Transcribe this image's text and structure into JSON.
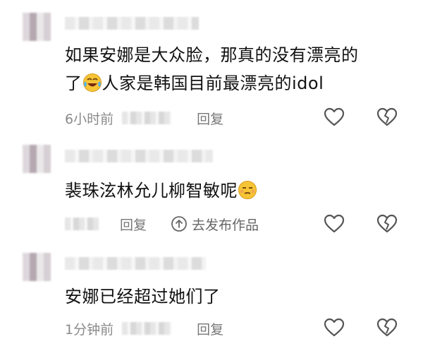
{
  "comments": [
    {
      "text_line1": "如果安娜是大众脸，那真的没有漂亮的",
      "text_line2_pre": "了",
      "text_line2_post": "人家是韩国目前最漂亮的idol",
      "emoji": "laugh-cry-emoji",
      "time": "6小时前",
      "reply_label": "回复"
    },
    {
      "text_pre": "裴珠泫林允儿柳智敏呢",
      "emoji": "smirk-emoji",
      "reply_label": "回复",
      "repost_label": "去发布作品"
    },
    {
      "text": "安娜已经超过她们了",
      "time": "1分钟前",
      "reply_label": "回复"
    }
  ],
  "icons": {
    "like": "heart-outline-icon",
    "dislike": "broken-heart-icon",
    "repost": "up-arrow-circle-icon"
  }
}
